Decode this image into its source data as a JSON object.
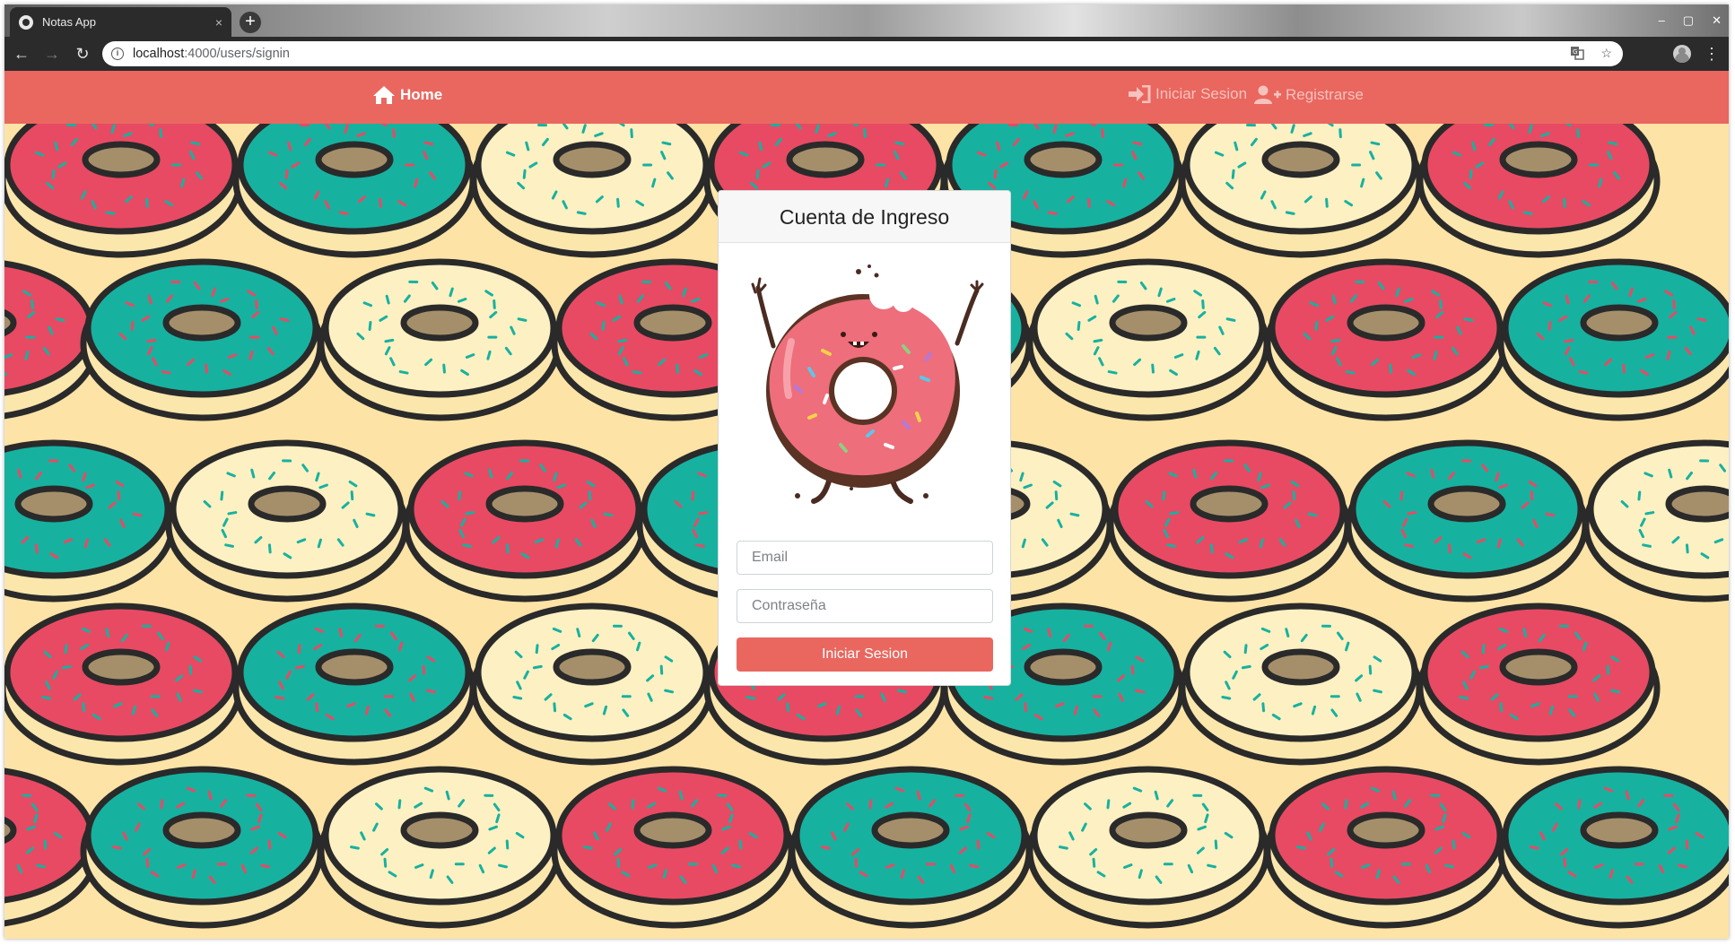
{
  "browser": {
    "tab_title": "Notas App",
    "tab_close": "×",
    "new_tab": "+",
    "url_host": "localhost",
    "url_path": ":4000/users/signin",
    "window_controls": [
      "–",
      "▢",
      "✕"
    ]
  },
  "navbar": {
    "home": "Home",
    "signin": "Iniciar Sesion",
    "signup": "Registrarse"
  },
  "card": {
    "title": "Cuenta de Ingreso",
    "email_placeholder": "Email",
    "password_placeholder": "Contraseña",
    "submit": "Iniciar Sesion"
  },
  "colors": {
    "navbar": "#e9675f",
    "background": "#fde3a5",
    "donut_pink": "#e84a63",
    "donut_teal": "#17b1a0",
    "donut_cream": "#fdf0c2"
  }
}
